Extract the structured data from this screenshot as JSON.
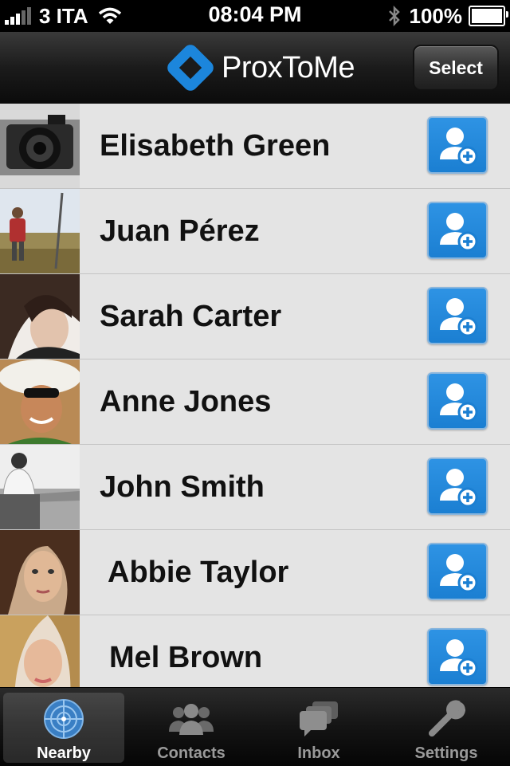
{
  "status_bar": {
    "carrier": "3 ITA",
    "time": "08:04 PM",
    "battery": "100%"
  },
  "nav": {
    "app_name": "ProxToMe",
    "select_label": "Select"
  },
  "people": [
    {
      "name": "Elisabeth Green",
      "avatar": "camera-photo"
    },
    {
      "name": "Juan Pérez",
      "avatar": "hiker-photo"
    },
    {
      "name": "Sarah Carter",
      "avatar": "portrait-photo"
    },
    {
      "name": "Anne Jones",
      "avatar": "sunhat-photo"
    },
    {
      "name": "John Smith",
      "avatar": "landscape-photo"
    },
    {
      "name": "Abbie Taylor",
      "avatar": "portrait-photo"
    },
    {
      "name": "Mel Brown",
      "avatar": "portrait-photo"
    }
  ],
  "tabs": [
    {
      "label": "Nearby",
      "icon": "radar-icon",
      "active": true
    },
    {
      "label": "Contacts",
      "icon": "contacts-icon",
      "active": false
    },
    {
      "label": "Inbox",
      "icon": "inbox-icon",
      "active": false
    },
    {
      "label": "Settings",
      "icon": "wrench-icon",
      "active": false
    }
  ],
  "colors": {
    "accent": "#1b7fd2",
    "row_bg": "#e4e4e4",
    "bar_dark": "#111111"
  }
}
